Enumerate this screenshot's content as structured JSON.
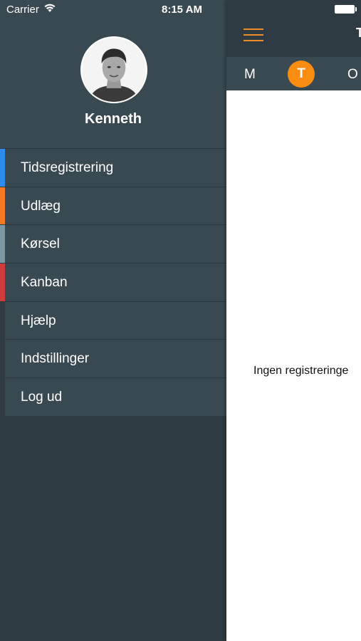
{
  "status_bar": {
    "carrier": "Carrier",
    "time": "8:15 AM"
  },
  "drawer": {
    "user_name": "Kenneth",
    "menu": [
      {
        "label": "Tidsregistrering",
        "accent": "#2d8cf0"
      },
      {
        "label": "Udlæg",
        "accent": "#f47920"
      },
      {
        "label": "Kørsel",
        "accent": "#7d97a3"
      },
      {
        "label": "Kanban",
        "accent": "#d03b3b"
      },
      {
        "label": "Hjælp",
        "accent": ""
      },
      {
        "label": "Indstillinger",
        "accent": ""
      },
      {
        "label": "Log ud",
        "accent": ""
      }
    ]
  },
  "main": {
    "title": "T",
    "days": {
      "monday": "M",
      "selected": "T",
      "wednesday": "O"
    },
    "empty_message": "Ingen registreringe"
  },
  "colors": {
    "orange": "#f88d12",
    "dark": "#2e3b42",
    "panel": "#394951"
  }
}
